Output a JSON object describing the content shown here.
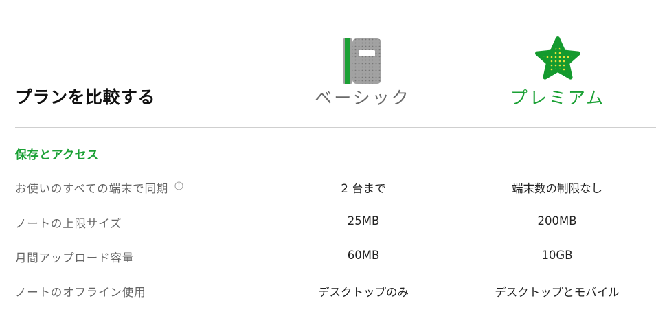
{
  "page_title": "プランを比較する",
  "plans": {
    "basic": {
      "name": "ベーシック",
      "icon": "notebook-icon",
      "color": "#6a6a6a"
    },
    "premium": {
      "name": "プレミアム",
      "icon": "star-icon",
      "color": "#1aa034"
    }
  },
  "section": {
    "title": "保存とアクセス",
    "color": "#1aa034"
  },
  "rows": [
    {
      "label": "お使いのすべての端末で同期",
      "info_icon": "info-icon",
      "basic": "2 台まで",
      "premium": "端末数の制限なし"
    },
    {
      "label": "ノートの上限サイズ",
      "basic": "25MB",
      "premium": "200MB"
    },
    {
      "label": "月間アップロード容量",
      "basic": "60MB",
      "premium": "10GB"
    },
    {
      "label": "ノートのオフライン使用",
      "basic": "デスクトップのみ",
      "premium": "デスクトップとモバイル"
    }
  ]
}
